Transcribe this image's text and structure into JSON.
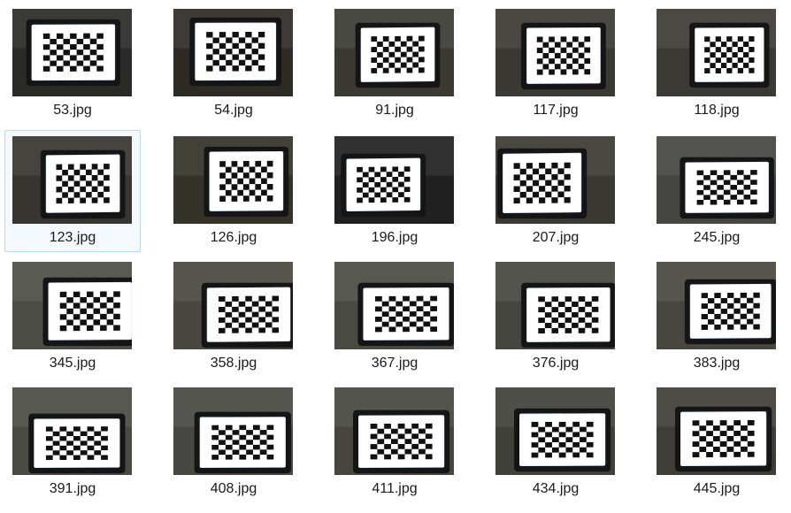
{
  "folder": {
    "selected_index": 5,
    "files": [
      {
        "name": "53.jpg",
        "thumbnail": "checkerboard-photo"
      },
      {
        "name": "54.jpg",
        "thumbnail": "checkerboard-photo"
      },
      {
        "name": "91.jpg",
        "thumbnail": "checkerboard-photo"
      },
      {
        "name": "117.jpg",
        "thumbnail": "checkerboard-photo"
      },
      {
        "name": "118.jpg",
        "thumbnail": "checkerboard-photo"
      },
      {
        "name": "123.jpg",
        "thumbnail": "checkerboard-photo"
      },
      {
        "name": "126.jpg",
        "thumbnail": "checkerboard-photo"
      },
      {
        "name": "196.jpg",
        "thumbnail": "checkerboard-photo"
      },
      {
        "name": "207.jpg",
        "thumbnail": "checkerboard-photo"
      },
      {
        "name": "245.jpg",
        "thumbnail": "checkerboard-photo"
      },
      {
        "name": "345.jpg",
        "thumbnail": "checkerboard-photo"
      },
      {
        "name": "358.jpg",
        "thumbnail": "checkerboard-photo"
      },
      {
        "name": "367.jpg",
        "thumbnail": "checkerboard-photo"
      },
      {
        "name": "376.jpg",
        "thumbnail": "checkerboard-photo"
      },
      {
        "name": "383.jpg",
        "thumbnail": "checkerboard-photo"
      },
      {
        "name": "391.jpg",
        "thumbnail": "checkerboard-photo"
      },
      {
        "name": "408.jpg",
        "thumbnail": "checkerboard-photo"
      },
      {
        "name": "411.jpg",
        "thumbnail": "checkerboard-photo"
      },
      {
        "name": "434.jpg",
        "thumbnail": "checkerboard-photo"
      },
      {
        "name": "445.jpg",
        "thumbnail": "checkerboard-photo"
      }
    ]
  }
}
